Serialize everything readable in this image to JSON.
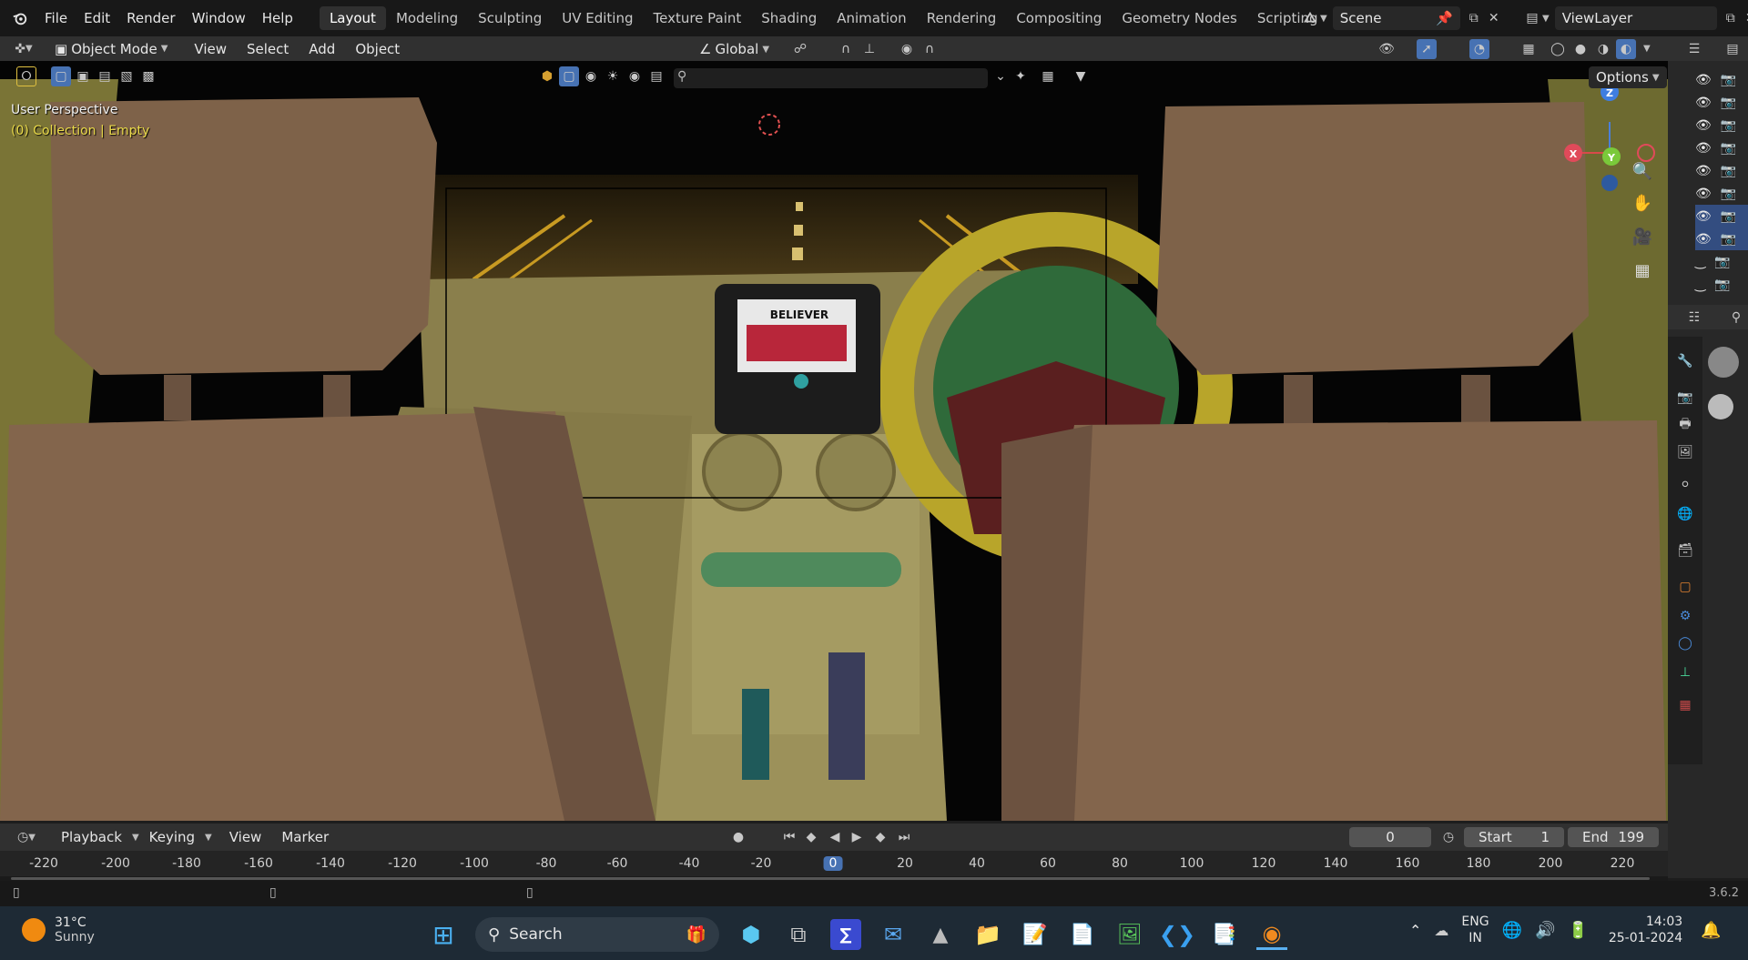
{
  "menu": [
    "File",
    "Edit",
    "Render",
    "Window",
    "Help"
  ],
  "workspaces": [
    "Layout",
    "Modeling",
    "Sculpting",
    "UV Editing",
    "Texture Paint",
    "Shading",
    "Animation",
    "Rendering",
    "Compositing",
    "Geometry Nodes",
    "Scripting"
  ],
  "active_workspace": "Layout",
  "scene": "Scene",
  "view_layer": "ViewLayer",
  "header": {
    "mode": "Object Mode",
    "menu": [
      "View",
      "Select",
      "Add",
      "Object"
    ],
    "transform_orientation": "Global",
    "options_label": "Options"
  },
  "viewport": {
    "perspective_label": "User Perspective",
    "collection_label": "(0) Collection | Empty",
    "screen_text": "BELIEVER",
    "gizmo": {
      "x": "X",
      "y": "Y",
      "z": "Z"
    }
  },
  "timeline": {
    "menu": [
      "Playback",
      "Keying",
      "View",
      "Marker"
    ],
    "current_frame": "0",
    "start_label": "Start",
    "start_value": "1",
    "end_label": "End",
    "end_value": "199",
    "ticks": [
      "-220",
      "-200",
      "-180",
      "-160",
      "-140",
      "-120",
      "-100",
      "-80",
      "-60",
      "-40",
      "-20",
      "0",
      "20",
      "40",
      "60",
      "80",
      "100",
      "120",
      "140",
      "160",
      "180",
      "200",
      "220"
    ]
  },
  "status": {
    "version": "3.6.2"
  },
  "taskbar": {
    "weather_temp": "31°C",
    "weather_desc": "Sunny",
    "search_placeholder": "Search",
    "lang_top": "ENG",
    "lang_bottom": "IN",
    "time": "14:03",
    "date": "25-01-2024"
  },
  "colors": {
    "accent": "#4772b3",
    "text_yellow": "#e9d94a",
    "active_frame": "#4772b3"
  }
}
